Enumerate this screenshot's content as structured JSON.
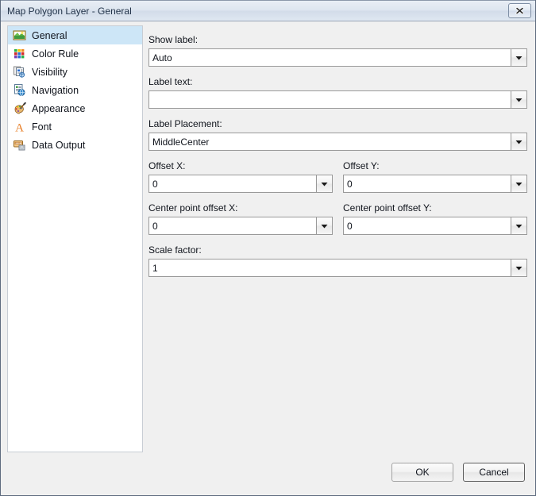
{
  "window": {
    "title": "Map Polygon Layer - General",
    "close_icon": "close-icon",
    "close_tooltip": "Close"
  },
  "sidebar": {
    "items": [
      {
        "label": "General",
        "icon": "picture-icon",
        "selected": true
      },
      {
        "label": "Color Rule",
        "icon": "color-grid-icon",
        "selected": false
      },
      {
        "label": "Visibility",
        "icon": "visibility-icon",
        "selected": false
      },
      {
        "label": "Navigation",
        "icon": "navigation-icon",
        "selected": false
      },
      {
        "label": "Appearance",
        "icon": "palette-icon",
        "selected": false
      },
      {
        "label": "Font",
        "icon": "font-a-icon",
        "selected": false
      },
      {
        "label": "Data Output",
        "icon": "data-output-icon",
        "selected": false
      }
    ]
  },
  "form": {
    "show_label": {
      "label": "Show label:",
      "value": "Auto",
      "placeholder": ""
    },
    "label_text": {
      "label": "Label text:",
      "value": "",
      "placeholder": ""
    },
    "label_placement": {
      "label": "Label Placement:",
      "value": "MiddleCenter",
      "placeholder": ""
    },
    "offset_x": {
      "label": "Offset X:",
      "value": "0",
      "placeholder": ""
    },
    "offset_y": {
      "label": "Offset Y:",
      "value": "0",
      "placeholder": ""
    },
    "center_point_offset_x": {
      "label": "Center point offset X:",
      "value": "0",
      "placeholder": ""
    },
    "center_point_offset_y": {
      "label": "Center point offset Y:",
      "value": "0",
      "placeholder": ""
    },
    "scale_factor": {
      "label": "Scale factor:",
      "value": "1",
      "placeholder": ""
    },
    "dropdown_icon": "chevron-down-icon"
  },
  "footer": {
    "ok_label": "OK",
    "cancel_label": "Cancel"
  },
  "colors": {
    "selection": "#cde6f7",
    "titlebar": "#dde5ef",
    "dialog_bg": "#f0f0f0",
    "field_bg": "#ffffff",
    "border": "#9a9a9a",
    "text": "#10141c"
  }
}
